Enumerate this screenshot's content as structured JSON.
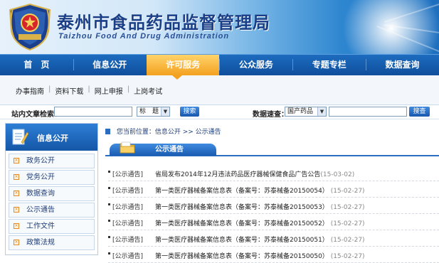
{
  "header": {
    "title": "泰州市食品药品监督管理局",
    "subtitle": "Taizhou Food And Drug Administration",
    "emblem_text": "泰州市食品药品监督管理局"
  },
  "nav": {
    "items": [
      {
        "label": "首　页"
      },
      {
        "label": "信息公开"
      },
      {
        "label": "许可服务",
        "active": true
      },
      {
        "label": "公众服务"
      },
      {
        "label": "专题专栏"
      },
      {
        "label": "数据查询"
      }
    ]
  },
  "subnav": {
    "links": [
      {
        "label": "办事指南"
      },
      {
        "label": "资料下载"
      },
      {
        "label": "网上申报"
      },
      {
        "label": "上岗考试"
      }
    ]
  },
  "search": {
    "site_label": "站内文章检索：",
    "site_input_value": "",
    "field_select": "标　题",
    "site_button": "搜索",
    "data_label": "数据速查：",
    "data_select": "国产药品",
    "data_input_value": "",
    "data_button": "搜查"
  },
  "sidebar": {
    "title": "信息公开",
    "items": [
      {
        "label": "政务公开"
      },
      {
        "label": "党务公开"
      },
      {
        "label": "数据查询"
      },
      {
        "label": "公示通告"
      },
      {
        "label": "工作文件"
      },
      {
        "label": "政策法规"
      }
    ]
  },
  "breadcrumb": "您当前位置：信息公开 >> 公示通告",
  "section_title": "公示通告",
  "notices": [
    {
      "category": "[公示通告]",
      "title": "省局发布2014年12月违法药品医疗器械保健食品广告公告",
      "date": "(15-03-02)"
    },
    {
      "category": "[公示通告]",
      "title": "第一类医疗器械备案信息表（备案号：苏泰械备20150054）",
      "date": "(15-02-27)"
    },
    {
      "category": "[公示通告]",
      "title": "第一类医疗器械备案信息表（备案号：苏泰械备20150053）",
      "date": "(15-02-27)"
    },
    {
      "category": "[公示通告]",
      "title": "第一类医疗器械备案信息表（备案号：苏泰械备20150052）",
      "date": "(15-02-27)"
    },
    {
      "category": "[公示通告]",
      "title": "第一类医疗器械备案信息表（备案号：苏泰械备20150051）",
      "date": "(15-02-27)"
    },
    {
      "category": "[公示通告]",
      "title": "第一类医疗器械备案信息表（备案号：苏泰械备20150050）",
      "date": "(15-02-27)"
    }
  ],
  "colors": {
    "nav_blue": "#1d6cbf",
    "nav_active": "#f3a11f",
    "title_blue": "#1a3f86"
  }
}
